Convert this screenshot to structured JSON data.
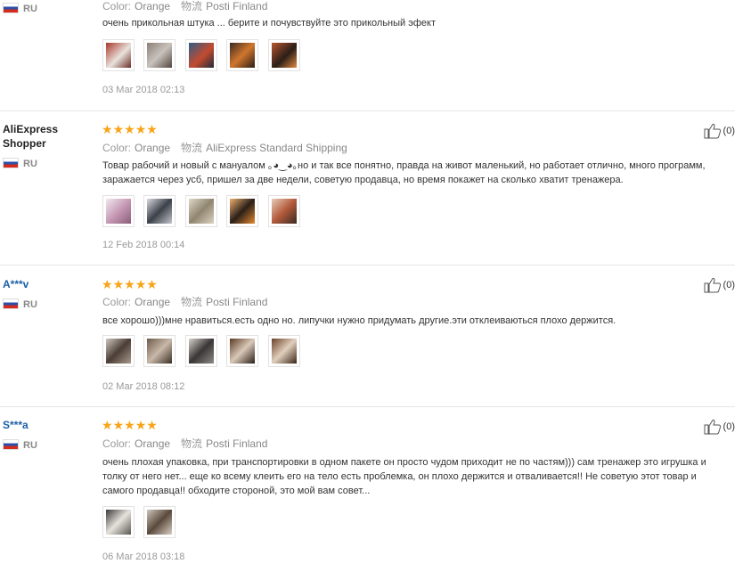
{
  "reviews": [
    {
      "user": "",
      "country": "RU",
      "color_label": "Color:",
      "color_value": "Orange",
      "shipping_label": "物流",
      "shipping_value": "Posti Finland",
      "text": "очень прикольная штука ... берите и почувствуйте это прикольный эфект",
      "date": "03 Mar 2018 02:13",
      "helpful": "",
      "thumb_colors": [
        "#b23a2a",
        "#7b6d66",
        "#3f6e99",
        "#c26a2f",
        "#a54b2b"
      ]
    },
    {
      "user": "AliExpress Shopper",
      "country": "RU",
      "stars": 5,
      "color_label": "Color:",
      "color_value": "Orange",
      "shipping_label": "物流",
      "shipping_value": "AliExpress Standard Shipping",
      "text": "Товар рабочий и новый с мануалом ｡◕‿◕｡но и так все понятно, правда на живот маленький, но работает отлично, много программ, заражается через усб, пришел за две недели, советую продавца, но время покажет на сколько хватит тренажера.",
      "date": "12 Feb 2018 00:14",
      "helpful": "(0)",
      "thumb_colors": [
        "#c79bb6",
        "#5e6470",
        "#b8a789",
        "#d37a2b",
        "#b35a3c"
      ]
    },
    {
      "user": "A***v",
      "country": "RU",
      "stars": 5,
      "color_label": "Color:",
      "color_value": "Orange",
      "shipping_label": "物流",
      "shipping_value": "Posti Finland",
      "text": "все хорошо)))мне нравиться.есть одно но. липучки нужно придумать другие.эти отклеиваються плохо держится.",
      "date": "02 Mar 2018 08:12",
      "helpful": "(0)",
      "thumb_colors": [
        "#6b5f57",
        "#8a6e4f",
        "#4a4a4a",
        "#9a6a45",
        "#8d5e3a"
      ]
    },
    {
      "user": "S***a",
      "country": "RU",
      "stars": 5,
      "color_label": "Color:",
      "color_value": "Orange",
      "shipping_label": "物流",
      "shipping_value": "Posti Finland",
      "text": "очень плохая упаковка, при транспортировки в одном пакете он просто чудом приходит не по частям))) сам тренажер это игрушка и толку от него нет... еще ко всему клеить его на тело есть проблемка, он плохо держится и отваливается!! Не советую этот товар и самого продавца!! обходите стороной, это мой вам совет...",
      "date": "06 Mar 2018 03:18",
      "helpful": "(0)",
      "thumb_colors": [
        "#d9d4cd",
        "#7d6f63"
      ]
    }
  ]
}
